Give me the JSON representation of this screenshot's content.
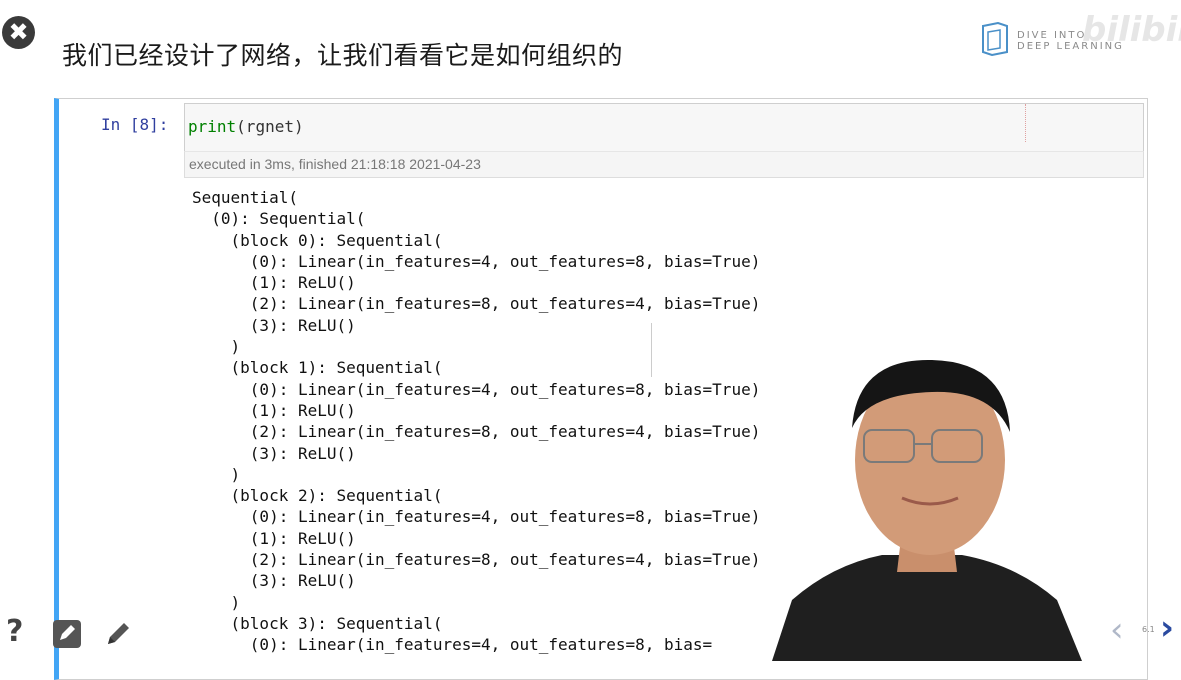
{
  "slide": {
    "title": "我们已经设计了网络，让我们看看它是如何组织的",
    "logo_line1": "DIVE INTO",
    "logo_line2": "DEEP LEARNING",
    "watermark": "bilibili",
    "slide_number": "6.1"
  },
  "cell": {
    "prompt": "In [8]:",
    "code_fn": "print",
    "code_args": "(rgnet)",
    "exec_info": "executed in 3ms, finished 21:18:18 2021-04-23",
    "output": "Sequential(\n  (0): Sequential(\n    (block 0): Sequential(\n      (0): Linear(in_features=4, out_features=8, bias=True)\n      (1): ReLU()\n      (2): Linear(in_features=8, out_features=4, bias=True)\n      (3): ReLU()\n    )\n    (block 1): Sequential(\n      (0): Linear(in_features=4, out_features=8, bias=True)\n      (1): ReLU()\n      (2): Linear(in_features=8, out_features=4, bias=True)\n      (3): ReLU()\n    )\n    (block 2): Sequential(\n      (0): Linear(in_features=4, out_features=8, bias=True)\n      (1): ReLU()\n      (2): Linear(in_features=8, out_features=4, bias=True)\n      (3): ReLU()\n    )\n    (block 3): Sequential(\n      (0): Linear(in_features=4, out_features=8, bias="
  },
  "icons": {
    "close": "close-icon",
    "help": "help-icon",
    "edit_box": "edit-box-icon",
    "pencil": "pencil-icon",
    "prev": "chevron-left-icon",
    "next": "chevron-right-icon"
  },
  "colors": {
    "cell_accent": "#42a5f5",
    "prompt": "#303f9f",
    "print_keyword": "#008000",
    "nav_next": "#2a4aa0"
  }
}
